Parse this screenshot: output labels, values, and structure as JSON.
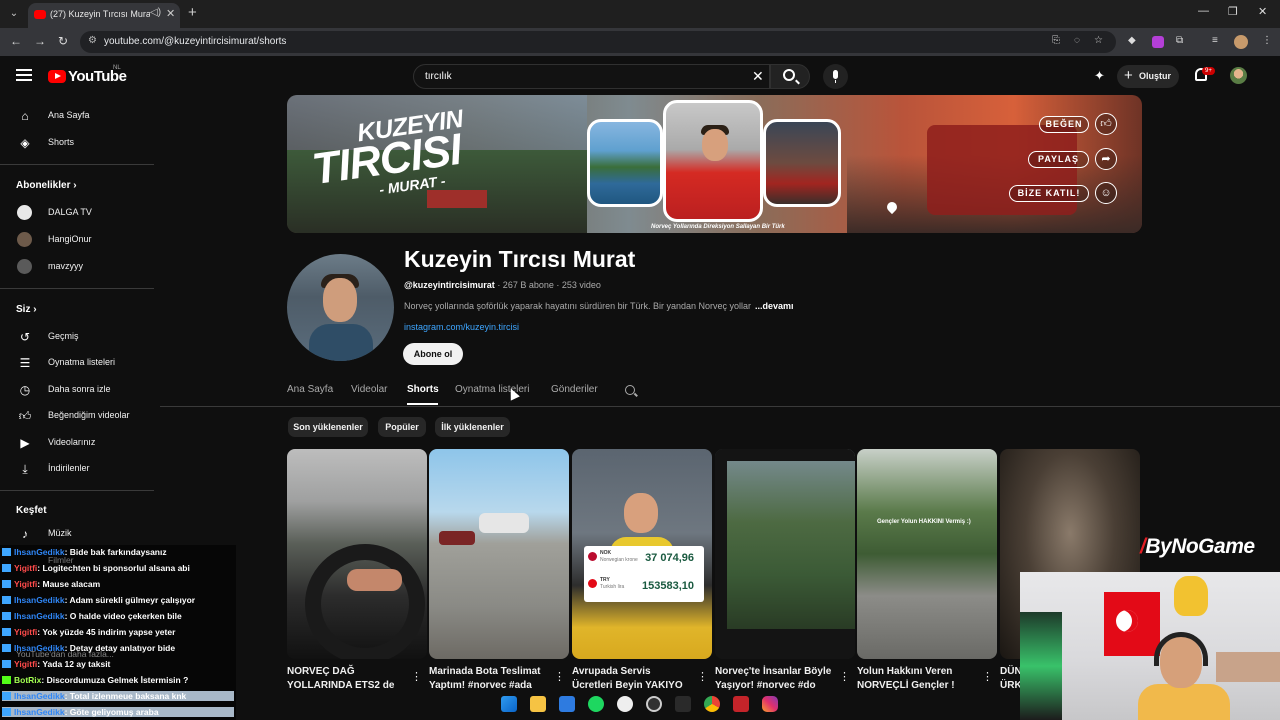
{
  "browser": {
    "tab_title": "(27) Kuzeyin Tırcısı Murat -",
    "url": "youtube.com/@kuzeyintircisimurat/shorts"
  },
  "header": {
    "logo_text": "YouTube",
    "logo_region": "NL",
    "search_value": "tırcılık",
    "create_label": "Oluştur",
    "notification_badge": "9+"
  },
  "sidebar": {
    "top_items": [
      {
        "label": "Ana Sayfa",
        "icon": "home-icon"
      },
      {
        "label": "Shorts",
        "icon": "shorts-icon"
      }
    ],
    "subscriptions_heading": "Abonelikler",
    "subscriptions": [
      {
        "label": "DALGA TV",
        "color": "#e8e8e8"
      },
      {
        "label": "HangiOnur",
        "color": "#6d5a4a"
      },
      {
        "label": "mavzyyy",
        "color": "#5a5a5a"
      }
    ],
    "you_heading": "Siz",
    "you_items": [
      {
        "label": "Geçmiş",
        "icon": "history-icon"
      },
      {
        "label": "Oynatma listeleri",
        "icon": "playlists-icon"
      },
      {
        "label": "Daha sonra izle",
        "icon": "watch-later-icon"
      },
      {
        "label": "Beğendiğim videolar",
        "icon": "liked-icon"
      },
      {
        "label": "Videolarınız",
        "icon": "your-videos-icon"
      },
      {
        "label": "İndirilenler",
        "icon": "downloads-icon"
      }
    ],
    "explore_heading": "Keşfet",
    "explore_items": [
      {
        "label": "Müzik",
        "icon": "music-icon"
      }
    ]
  },
  "banner": {
    "title_line1": "KUZEYIN",
    "title_line2": "TIRCISI",
    "title_line3": "- MURAT -",
    "caption": "Norveç Yollarında Direksiyon Sallayan Bir Türk",
    "buttons": [
      {
        "label": "BEĞEN",
        "icon": "thumbs-up-icon"
      },
      {
        "label": "PAYLAŞ",
        "icon": "share-icon"
      },
      {
        "label": "BİZE KATIL!",
        "icon": "group-icon"
      }
    ]
  },
  "channel": {
    "name": "Kuzeyin Tırcısı Murat",
    "handle": "@kuzeyintircisimurat",
    "stats": " · 267 B abone · 253 video",
    "description": "Norveç yollarında şoförlük yaparak hayatını sürdüren bir Türk. Bir yandan Norveç yollar",
    "more": "...devamı",
    "link": "instagram.com/kuzeyin.tircisi",
    "subscribe_label": "Abone ol"
  },
  "tabs": [
    "Ana Sayfa",
    "Videolar",
    "Shorts",
    "Oynatma listeleri",
    "Gönderiler"
  ],
  "active_tab": "Shorts",
  "chips": [
    "Son yüklenenler",
    "Popüler",
    "İlk yüklenenler"
  ],
  "shorts": [
    {
      "title": "NORVEÇ DAĞ",
      "title2": "YOLLARINDA ETS2 de"
    },
    {
      "title": "Marinada Bota Teslimat",
      "title2": "Yaptım! #norvec #ada"
    },
    {
      "title": "Avrupada Servis",
      "title2": "Ücretleri Beyin YAKIYO"
    },
    {
      "title": "Norveç'te İnsanlar Böyle",
      "title2": "Yaşıyor! #norvec #do"
    },
    {
      "title": "Yolun Hakkını Veren",
      "title2": "NORVEÇLİ Gençler !"
    },
    {
      "title": "DÜN",
      "title2": "ÜRK"
    }
  ],
  "short3_card": {
    "top_currency": "NOK",
    "top_sub": "Norwegian krone",
    "top_value": "37 074,96",
    "bottom_currency": "TRY",
    "bottom_sub": "Turkish lira",
    "bottom_value": "153583,10"
  },
  "short5_overlay": "Gençler Yolun HAKKINI Vermiş :)",
  "overlay": {
    "sponsor": "ByNoGame",
    "chat": [
      {
        "user": "IhsanGedikk",
        "text": ": Bide bak farkındaysanız",
        "color": "u1"
      },
      {
        "user": "Yigitfi",
        "text": ": Logitechten bi sponsorlul alsana abi",
        "color": "u2"
      },
      {
        "user": "Yigitfi",
        "text": ": Mause alacam",
        "color": "u2"
      },
      {
        "user": "IhsanGedikk",
        "text": ": Adam sürekli gülmeyr çalışıyor",
        "color": "u1"
      },
      {
        "user": "IhsanGedikk",
        "text": ": O halde video çekerken bile",
        "color": "u1"
      },
      {
        "user": "Yigitfi",
        "text": ": Yok yüzde 45 indirim yapse yeter",
        "color": "u2"
      },
      {
        "user": "IhsanGedikk",
        "text": ": Detay detay anlatıyor bide",
        "color": "u1"
      },
      {
        "user": "Yigitfi",
        "text": ": Yada 12 ay taksit",
        "color": "u2"
      },
      {
        "user": "BotRix",
        "text": ": Discordumuza Gelmek İstermisin ?",
        "color": "u3"
      },
      {
        "user": "IhsanGedikk",
        "text": ": Total izlenmeue baksana knk",
        "color": "u1"
      },
      {
        "user": "IhsanGedikk",
        "text": ": Göte geliyomuş araba",
        "color": "u1"
      }
    ],
    "faded_sidebar_1": "Filmler",
    "faded_sidebar_2": "YouTube'dan daha fazla..."
  },
  "taskbar_icons": [
    "windows-icon",
    "file-explorer-icon",
    "store-icon",
    "spotify-icon",
    "app-icon",
    "obs-icon",
    "epic-icon",
    "chrome-icon",
    "app-icon-2",
    "instagram-icon"
  ]
}
